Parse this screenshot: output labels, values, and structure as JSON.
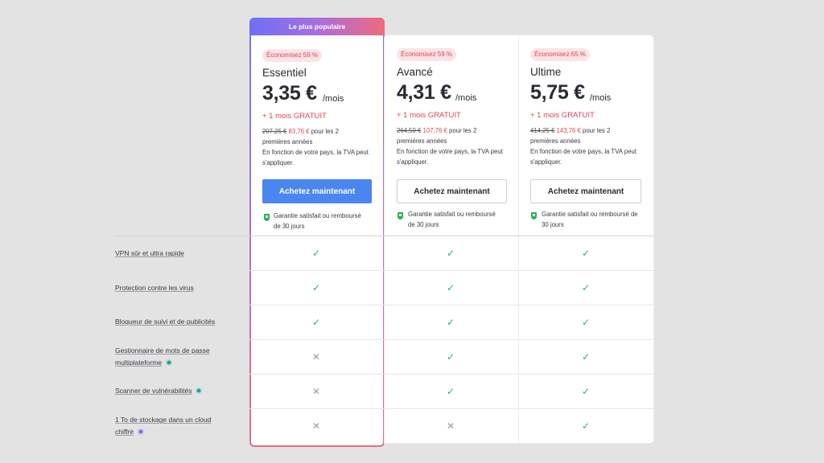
{
  "ribbon": "Le plus populaire",
  "plans": [
    {
      "badge": "Économisez 59 %",
      "name": "Essentiel",
      "price": "3,35 €",
      "per": "/mois",
      "free": "+ 1 mois GRATUIT",
      "old_price": "207,25 €",
      "new_price": "83,76 €",
      "period_text_1": " pour les 2",
      "period_text_2": "premières années",
      "vat_1": "En fonction de votre pays, la TVA peut",
      "vat_2": "s'appliquer.",
      "button": "Achetez maintenant",
      "button_style": "primary",
      "guarantee_1": "Garantie satisfait ou remboursé",
      "guarantee_2": "de 30 jours"
    },
    {
      "badge": "Économisez 59 %",
      "name": "Avancé",
      "price": "4,31 €",
      "per": "/mois",
      "free": "+ 1 mois GRATUIT",
      "old_price": "264,50 €",
      "new_price": "107,76 €",
      "period_text_1": " pour les 2",
      "period_text_2": "premières années",
      "vat_1": "En fonction de votre pays, la TVA peut",
      "vat_2": "s'appliquer.",
      "button": "Achetez maintenant",
      "button_style": "outline",
      "guarantee_1": "Garantie satisfait ou remboursé",
      "guarantee_2": "de 30 jours"
    },
    {
      "badge": "Économisez 65 %",
      "name": "Ultime",
      "price": "5,75 €",
      "per": "/mois",
      "free": "+ 1 mois GRATUIT",
      "old_price": "414,25 €",
      "new_price": "143,76 €",
      "period_text_1": " pour les 2",
      "period_text_2": "premières années",
      "vat_1": "En fonction de votre pays, la TVA peut",
      "vat_2": "s'appliquer.",
      "button": "Achetez maintenant",
      "button_style": "outline",
      "guarantee_1": "Garantie satisfait ou remboursé de",
      "guarantee_2": "30 jours"
    }
  ],
  "features": [
    {
      "label_1": "VPN sûr et ultra rapide",
      "label_2": "",
      "info": "",
      "values": [
        "check",
        "check",
        "check"
      ]
    },
    {
      "label_1": "Protection contre les virus",
      "label_2": "",
      "info": "",
      "values": [
        "check",
        "check",
        "check"
      ]
    },
    {
      "label_1": "Bloqueur de suivi et de publicités",
      "label_2": "",
      "info": "",
      "values": [
        "check",
        "check",
        "check"
      ]
    },
    {
      "label_1": "Gestionnaire de mots de passe",
      "label_2": "multiplateforme",
      "info": "teal",
      "values": [
        "cross",
        "check",
        "check"
      ]
    },
    {
      "label_1": "Scanner de vulnérabilités",
      "label_2": "",
      "info": "teal",
      "values": [
        "cross",
        "check",
        "check"
      ]
    },
    {
      "label_1": "1 To de stockage dans un cloud",
      "label_2": "chiffré",
      "info": "purple",
      "values": [
        "cross",
        "cross",
        "check"
      ]
    }
  ],
  "colors": {
    "accent_blue": "#4a86f0",
    "check_green": "#2fae5b",
    "price_red": "#e0454f"
  }
}
